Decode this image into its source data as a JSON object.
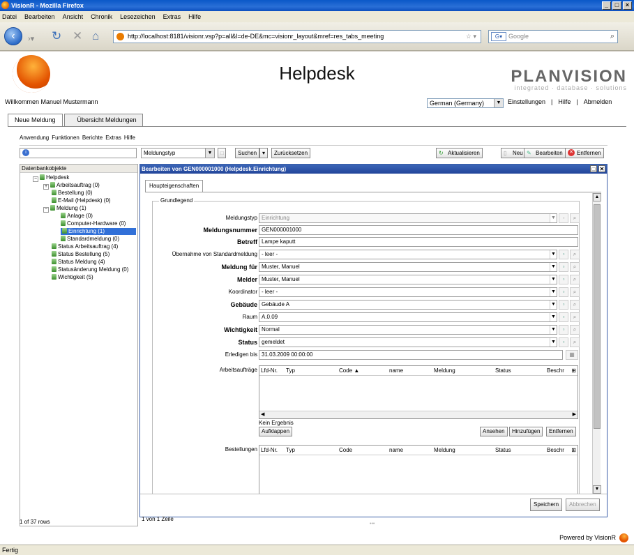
{
  "browser": {
    "title": "VisionR - Mozilla Firefox",
    "menu": [
      "Datei",
      "Bearbeiten",
      "Ansicht",
      "Chronik",
      "Lesezeichen",
      "Extras",
      "Hilfe"
    ],
    "url": "http://localhost:8181/visionr.vsp?p=all&l=de-DE&mc=visionr_layout&mref=res_tabs_meeting",
    "search_placeholder": "Google",
    "status": "Fertig"
  },
  "header": {
    "title": "Helpdesk",
    "brand": "PLANVISION",
    "brand_tagline": "integrated · database · solutions",
    "welcome": "Willkommen  Manuel Mustermann",
    "language": "German (Germany)",
    "links": [
      "Einstellungen",
      "|",
      "Hilfe",
      "|",
      "Abmelden"
    ]
  },
  "tabs": [
    "Neue Meldung",
    "Übersicht Meldungen"
  ],
  "app_menu": [
    "Anwendung",
    "Funktionen",
    "Berichte",
    "Extras",
    "Hilfe"
  ],
  "toolbar": {
    "type_select": "Meldungstyp",
    "search": "Suchen",
    "reset": "Zurücksetzen",
    "refresh": "Aktualisieren",
    "new": "Neu",
    "edit": "Bearbeiten",
    "remove": "Entfernen"
  },
  "tree": {
    "header": "Datenbankobjekte",
    "footer": "1 of 37 rows",
    "items": [
      "Helpdesk",
      "Arbeitsauftrag (0)",
      "Bestellung (0)",
      "E-Mail (Helpdesk) (0)",
      "Meldung (1)",
      "Anlage (0)",
      "Computer-Hardware (0)",
      "Einrichtung (1)",
      "Standardmeldung (0)",
      "Status Arbeitsauftrag (4)",
      "Status Bestellung (5)",
      "Status Meldung (4)",
      "Statusänderung Meldung (0)",
      "Wichtigkeit (5)"
    ]
  },
  "editor": {
    "title": "Bearbeiten von  GEN000001000 (Helpdesk.Einrichtung)",
    "subtab": "Haupteigenschaften",
    "group": "Grundlegend",
    "fields": [
      {
        "label": "Meldungstyp",
        "value": "Einrichtung"
      },
      {
        "label": "Meldungsnummer",
        "value": "GEN000001000"
      },
      {
        "label": "Betreff",
        "value": "Lampe kaputt"
      },
      {
        "label": "Übernahme von Standardmeldung",
        "value": "- leer -"
      },
      {
        "label": "Meldung für",
        "value": "Muster, Manuel"
      },
      {
        "label": "Melder",
        "value": "Muster, Manuel"
      },
      {
        "label": "Koordinator",
        "value": "- leer -"
      },
      {
        "label": "Gebäude",
        "value": "Gebäude A"
      },
      {
        "label": "Raum",
        "value": "A.0.09"
      },
      {
        "label": "Wichtigkeit",
        "value": "Normal"
      },
      {
        "label": "Status",
        "value": "gemeldet"
      },
      {
        "label": "Erledigen bis",
        "value": "31.03.2009 00:00:00"
      }
    ],
    "grid1": {
      "label": "Arbeitsaufträge",
      "columns": [
        "Lfd-Nr.",
        "Typ",
        "Code ▲",
        "name",
        "Meldung",
        "Status",
        "Beschr"
      ],
      "empty": "Kein Ergebnis",
      "expand": "Aufklappen",
      "buttons": [
        "Ansehen",
        "Hinzufügen",
        "Entfernen"
      ]
    },
    "grid2": {
      "label": "Bestellungen",
      "columns": [
        "Lfd-Nr.",
        "Typ",
        "Code",
        "name",
        "Meldung",
        "Status",
        "Beschr"
      ]
    },
    "save": "Speichern",
    "cancel": "Abbrechen",
    "footer": "1 von 1 Zeile"
  },
  "powered": "Powered by VisionR"
}
